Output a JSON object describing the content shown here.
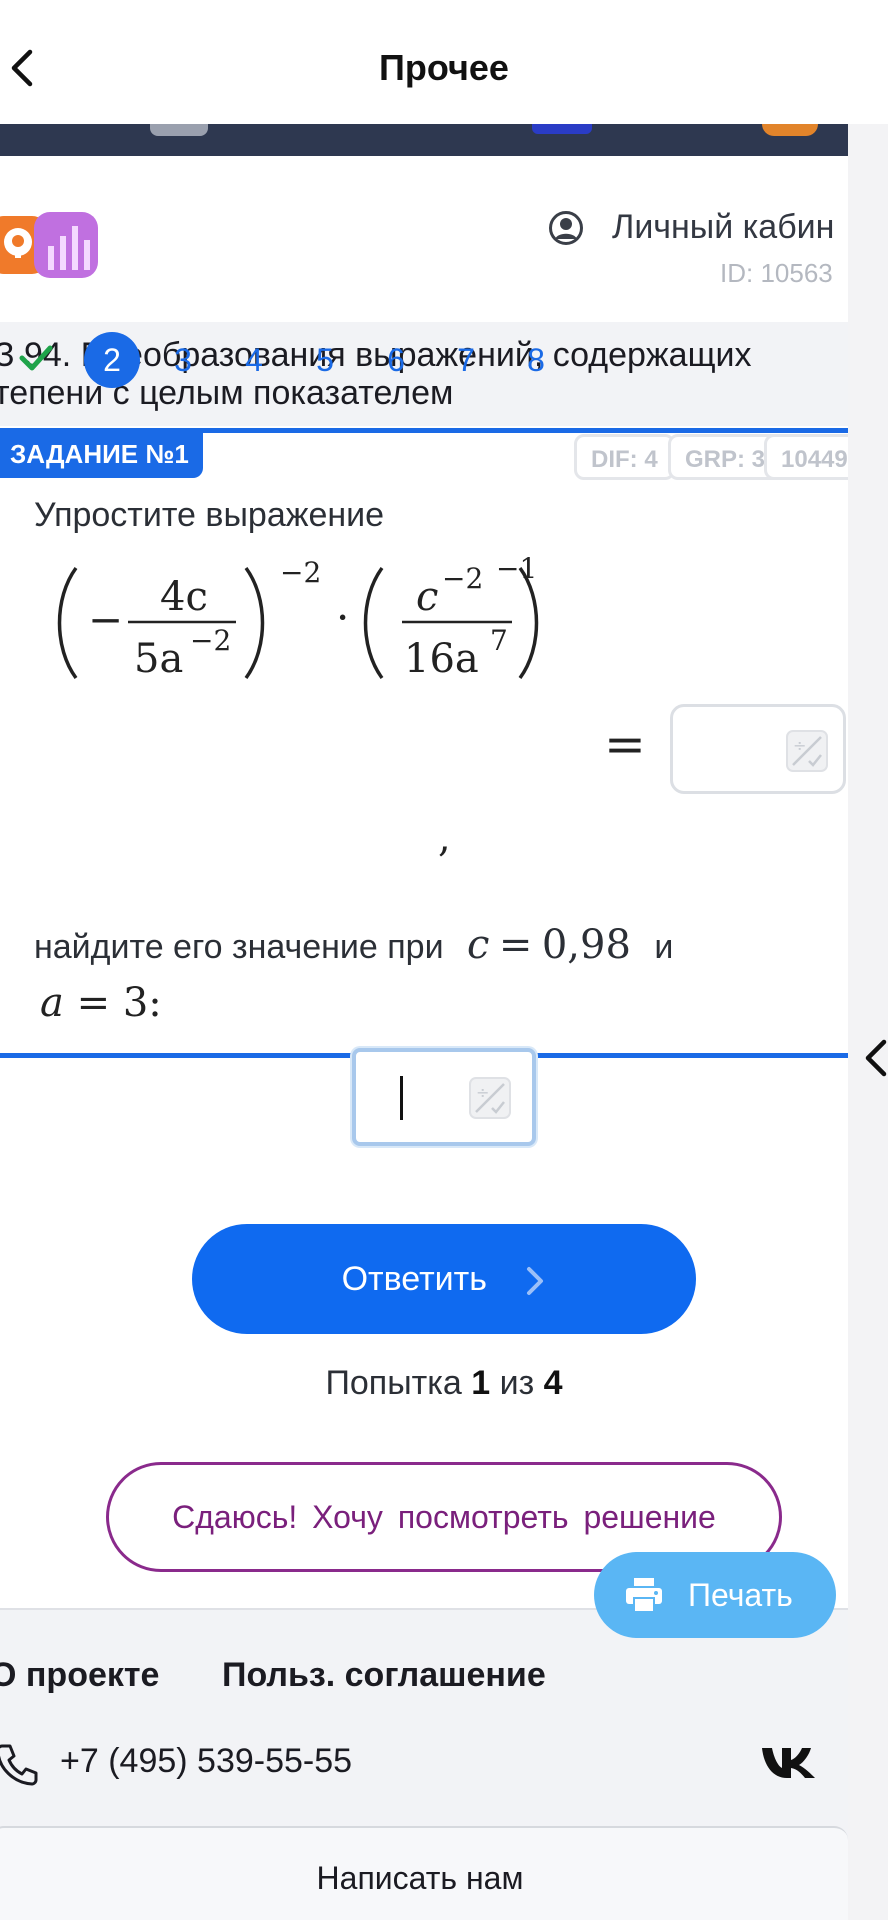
{
  "nav": {
    "title": "Прочее"
  },
  "header": {
    "account_label": "Личный кабин",
    "user_id": "ID: 10563"
  },
  "page": {
    "title_line1": "З 94. Преобразования выражений, содержащих",
    "title_line2": "тепени с целым показателем"
  },
  "pager": {
    "items": [
      "2",
      "3",
      "4",
      "5",
      "6",
      "7",
      "8"
    ],
    "active": "2"
  },
  "task": {
    "label": "ЗАДАНИЕ №1",
    "chips": [
      "DIF: 4",
      "GRP: 3",
      "10449"
    ],
    "prompt": "Упростите выражение",
    "formula": {
      "frac1_num": "4c",
      "frac1_den": "5a",
      "frac1_den_exp": "−2",
      "outer_exp1": "−2",
      "dot": "·",
      "frac2_num": "c",
      "frac2_num_exp": "−2",
      "frac2_den": "16a",
      "frac2_den_exp": "7",
      "outer_exp2": "−1",
      "minus": "−"
    },
    "equals": "=",
    "comma": ",",
    "find_text": "найдите его значение при",
    "c_var": "c",
    "c_value": "0,98",
    "and_word": "и",
    "a_var": "a",
    "a_value": "3:",
    "answer1_value": "",
    "answer2_value": ""
  },
  "actions": {
    "submit_label": "Ответить",
    "attempt_prefix": "Попытка",
    "attempt_current": "1",
    "attempt_mid": "из",
    "attempt_total": "4",
    "giveup_label": "Сдаюсь! Хочу посмотреть решение",
    "print_label": "Печать"
  },
  "footer": {
    "about": "О проекте",
    "agreement": "Польз. соглашение",
    "phone": "+7 (495) 539-55-55",
    "write_us": "Написать нам"
  },
  "colors": {
    "accent": "#1a6ae6",
    "giveup": "#8a2a8c",
    "print": "#5ab6f4",
    "check": "#1fa34a"
  },
  "icons": [
    "chevron-left-icon",
    "user-circle-icon",
    "check-icon",
    "calculator-icon",
    "chevron-right-icon",
    "printer-icon",
    "phone-icon",
    "vk-icon",
    "collapse-chevron-icon"
  ]
}
